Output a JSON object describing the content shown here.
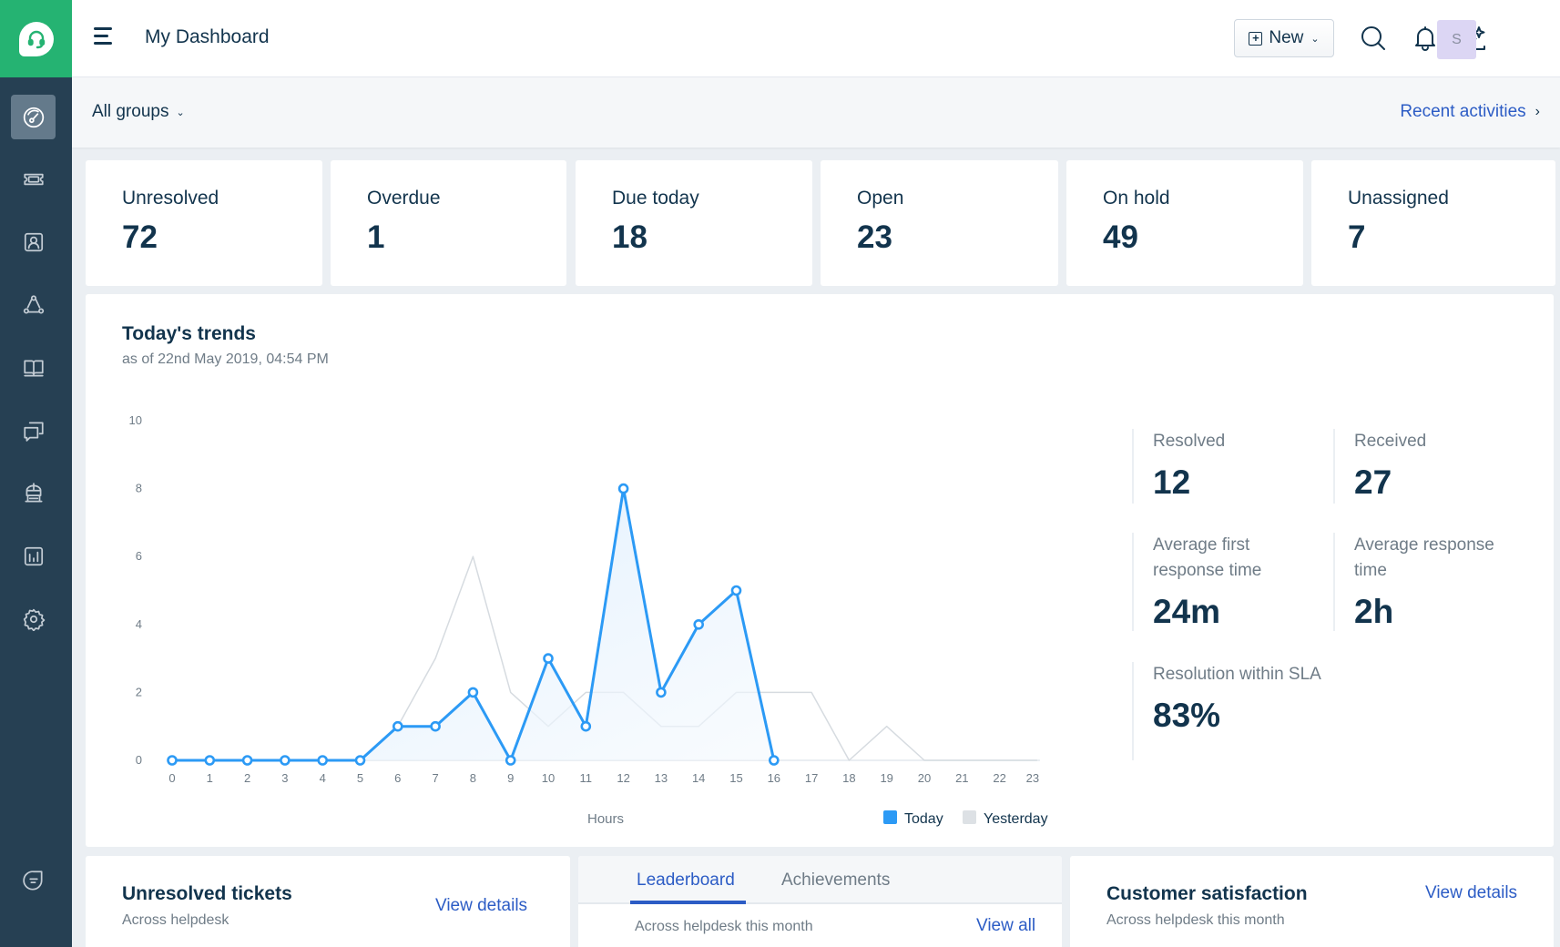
{
  "app": {
    "logo_icon": "headset-icon"
  },
  "sidebar": {
    "items": [
      {
        "name": "dashboard",
        "icon": "gauge-icon",
        "active": true
      },
      {
        "name": "tickets",
        "icon": "ticket-icon",
        "active": false
      },
      {
        "name": "contacts",
        "icon": "contact-icon",
        "active": false
      },
      {
        "name": "groups",
        "icon": "network-icon",
        "active": false
      },
      {
        "name": "solutions",
        "icon": "book-icon",
        "active": false
      },
      {
        "name": "forums",
        "icon": "chat-icon",
        "active": false
      },
      {
        "name": "arcade",
        "icon": "arena-icon",
        "active": false
      },
      {
        "name": "reports",
        "icon": "bar-chart-icon",
        "active": false
      },
      {
        "name": "admin",
        "icon": "gear-icon",
        "active": false
      }
    ],
    "bottom_icon": "freshchat-icon"
  },
  "header": {
    "title": "My Dashboard",
    "new_button": "New",
    "avatar_initial": "S"
  },
  "group_bar": {
    "selected_group": "All groups",
    "recent_activities": "Recent activities"
  },
  "stats": [
    {
      "label": "Unresolved",
      "value": "72"
    },
    {
      "label": "Overdue",
      "value": "1"
    },
    {
      "label": "Due today",
      "value": "18"
    },
    {
      "label": "Open",
      "value": "23"
    },
    {
      "label": "On hold",
      "value": "49"
    },
    {
      "label": "Unassigned",
      "value": "7"
    }
  ],
  "trends": {
    "title": "Today's trends",
    "subtitle": "as of 22nd May 2019, 04:54 PM",
    "metrics": [
      {
        "label": "Resolved",
        "value": "12"
      },
      {
        "label": "Received",
        "value": "27"
      },
      {
        "label": "Average first response time",
        "value": "24m"
      },
      {
        "label": "Average response time",
        "value": "2h"
      },
      {
        "label": "Resolution within SLA",
        "value": "83%"
      }
    ]
  },
  "chart_data": {
    "type": "line",
    "title": "Today's trends",
    "xlabel": "Hours",
    "ylabel": "",
    "x": [
      0,
      1,
      2,
      3,
      4,
      5,
      6,
      7,
      8,
      9,
      10,
      11,
      12,
      13,
      14,
      15,
      16,
      17,
      18,
      19,
      20,
      21,
      22,
      23
    ],
    "y_ticks": [
      0,
      2,
      4,
      6,
      8,
      10
    ],
    "ylim": [
      0,
      10
    ],
    "grid": false,
    "legend_position": "bottom-right",
    "series": [
      {
        "name": "Today",
        "color": "#2c9af5",
        "values": [
          0,
          0,
          0,
          0,
          0,
          0,
          1,
          1,
          2,
          0,
          3,
          1,
          8,
          2,
          4,
          5,
          0
        ],
        "area": true,
        "markers": true
      },
      {
        "name": "Yesterday",
        "color": "#d6dbe0",
        "values": [
          0,
          0,
          0,
          0,
          0,
          0,
          1,
          3,
          6,
          2,
          1,
          2,
          2,
          1,
          1,
          2,
          2,
          2,
          0,
          1,
          0,
          0,
          0,
          0
        ],
        "area": false,
        "markers": false
      }
    ]
  },
  "bottom": {
    "unresolved": {
      "title": "Unresolved tickets",
      "subtitle": "Across helpdesk",
      "link": "View details"
    },
    "leaderboard": {
      "tabs": [
        "Leaderboard",
        "Achievements"
      ],
      "active_tab": 0,
      "subtitle": "Across helpdesk this month",
      "link": "View all"
    },
    "csat": {
      "title": "Customer satisfaction",
      "subtitle": "Across helpdesk this month",
      "link": "View details"
    }
  },
  "colors": {
    "brand_green": "#25b372",
    "sidebar_bg": "#264053",
    "link_blue": "#2c5cc5",
    "today_blue": "#2c9af5",
    "yesterday_gray": "#d6dbe0"
  }
}
